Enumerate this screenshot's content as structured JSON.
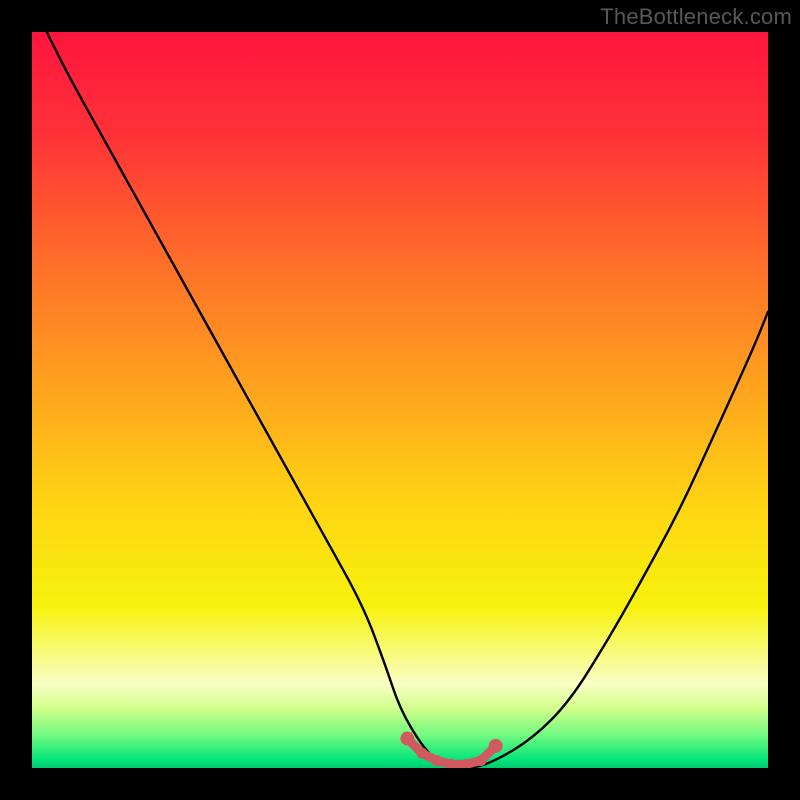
{
  "watermark": "TheBottleneck.com",
  "colors": {
    "page_bg": "#000000",
    "gradient_stops": [
      {
        "offset": 0,
        "color": "#ff153f"
      },
      {
        "offset": 0.14,
        "color": "#ff3238"
      },
      {
        "offset": 0.3,
        "color": "#ff6a2a"
      },
      {
        "offset": 0.48,
        "color": "#ffa21e"
      },
      {
        "offset": 0.64,
        "color": "#ffd413"
      },
      {
        "offset": 0.78,
        "color": "#f7f20c"
      },
      {
        "offset": 0.885,
        "color": "#f8ffc4"
      },
      {
        "offset": 0.92,
        "color": "#d0ff8a"
      },
      {
        "offset": 0.955,
        "color": "#72fa80"
      },
      {
        "offset": 0.99,
        "color": "#00e47a"
      },
      {
        "offset": 1.0,
        "color": "#00c86e"
      }
    ],
    "curve": "#000000",
    "marker": "#d05a5f"
  },
  "chart_data": {
    "type": "line",
    "title": "",
    "xlabel": "",
    "ylabel": "",
    "xlim": [
      0,
      100
    ],
    "ylim": [
      0,
      100
    ],
    "grid": false,
    "legend": false,
    "annotations": [
      "TheBottleneck.com"
    ],
    "series": [
      {
        "name": "bottleneck-curve",
        "x": [
          2,
          5,
          10,
          15,
          20,
          25,
          30,
          35,
          40,
          45,
          48,
          50,
          53,
          55,
          58,
          60,
          63,
          68,
          73,
          78,
          82,
          88,
          93,
          98,
          100
        ],
        "y": [
          100,
          94,
          85,
          76,
          67,
          58,
          49,
          40,
          31,
          22,
          14,
          8,
          3,
          1,
          0,
          0,
          1,
          4,
          9,
          17,
          24,
          35,
          46,
          57,
          62
        ]
      }
    ],
    "markers": {
      "name": "trough-markers",
      "color": "#d05a5f",
      "x": [
        51,
        53,
        55,
        57,
        59,
        61,
        63
      ],
      "y": [
        4,
        2,
        1,
        0.5,
        0.5,
        1,
        3
      ]
    }
  }
}
